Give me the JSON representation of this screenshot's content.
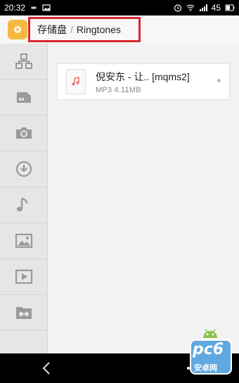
{
  "status_bar": {
    "time": "20:32",
    "battery": "45"
  },
  "header": {
    "breadcrumb_root": "存储盘",
    "breadcrumb_separator": "/",
    "breadcrumb_current": "Ringtones",
    "highlight_color": "#d9272e"
  },
  "sidebar": {
    "items": [
      {
        "icon": "network-icon"
      },
      {
        "icon": "sd-card-icon"
      },
      {
        "icon": "camera-icon"
      },
      {
        "icon": "download-icon"
      },
      {
        "icon": "music-icon"
      },
      {
        "icon": "image-icon"
      },
      {
        "icon": "video-icon"
      },
      {
        "icon": "private-folder-icon"
      }
    ]
  },
  "files": [
    {
      "name": "倪安东 - 让.. [mqms2]",
      "meta": "MP3 4.11MB",
      "icon": "music-file-icon"
    }
  ],
  "watermark": {
    "brand": "pc6",
    "subtitle": "安卓网"
  }
}
